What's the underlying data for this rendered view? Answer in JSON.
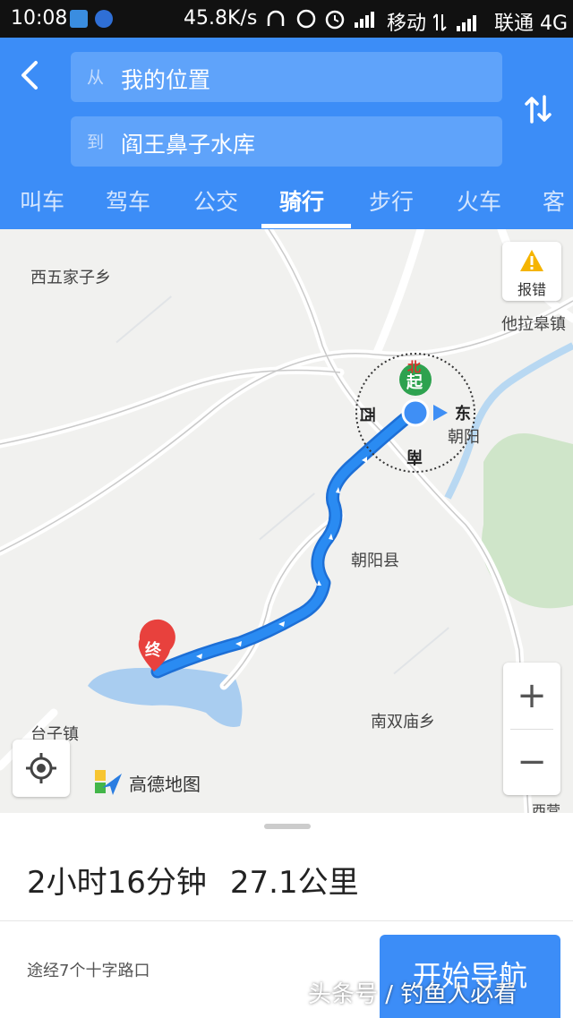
{
  "status_bar": {
    "time": "10:08",
    "net_speed": "45.8K/s",
    "carrier1": "移动",
    "carrier2": "联通 4G"
  },
  "route": {
    "from_prefix": "从",
    "from_value": "我的位置",
    "to_prefix": "到",
    "to_value": "阎王鼻子水库"
  },
  "modes": [
    "叫车",
    "驾车",
    "公交",
    "骑行",
    "步行",
    "火车",
    "客"
  ],
  "active_mode": "骑行",
  "map": {
    "places": {
      "p1": "西五家子乡",
      "p2": "他拉皋镇",
      "p3": "朝阳",
      "p4": "朝阳县",
      "p5": "南双庙乡",
      "p6": "台子镇",
      "p7": "西营子"
    },
    "compass": {
      "north": "北",
      "east": "东",
      "south": "南",
      "west": "西"
    },
    "start_label": "起",
    "end_label": "终",
    "report_label": "报错",
    "zoom_in": "+",
    "zoom_out": "−",
    "brand": "高德地图",
    "route_color": "#2a8bf2",
    "lake_color": "#a9cdf0"
  },
  "summary": {
    "duration": "2小时16分钟",
    "distance": "27.1公里",
    "via": "途经7个十字路口",
    "nav_button": "开始导航"
  },
  "watermark": "头条号 / 钓鱼人必看"
}
